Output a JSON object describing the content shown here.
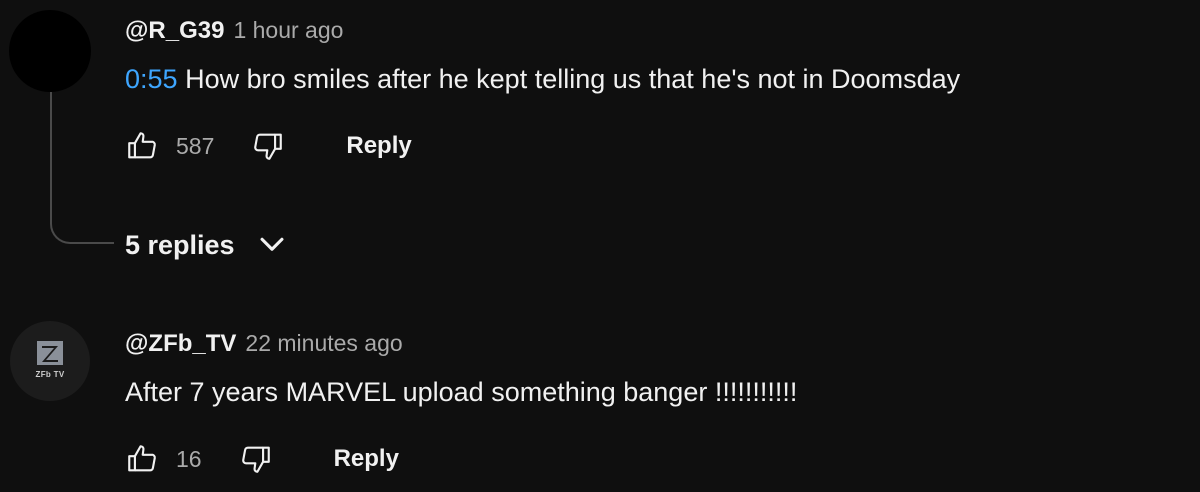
{
  "comments": [
    {
      "handle": "@R_G39",
      "time": "1 hour ago",
      "timestamp_link": "0:55",
      "text": " How bro smiles after he kept telling us that he's not in Doomsday",
      "likes": "587",
      "reply_label": "Reply",
      "replies_label": "5 replies",
      "avatar_color": "#000000"
    },
    {
      "handle": "@ZFb_TV",
      "time": "22 minutes ago",
      "text": "After 7 years MARVEL upload something banger !!!!!!!!!!!",
      "likes": "16",
      "reply_label": "Reply",
      "avatar_logo_text": "ZFb TV",
      "avatar_color": "#1c1c1c"
    }
  ],
  "colors": {
    "background": "#0f0f0f",
    "link": "#3ea6ff",
    "primary_text": "#f1f1f1",
    "secondary_text": "#aaaaaa"
  },
  "icons": {
    "like": "thumbs-up-outline",
    "dislike": "thumbs-down-outline",
    "expand": "chevron-down"
  }
}
